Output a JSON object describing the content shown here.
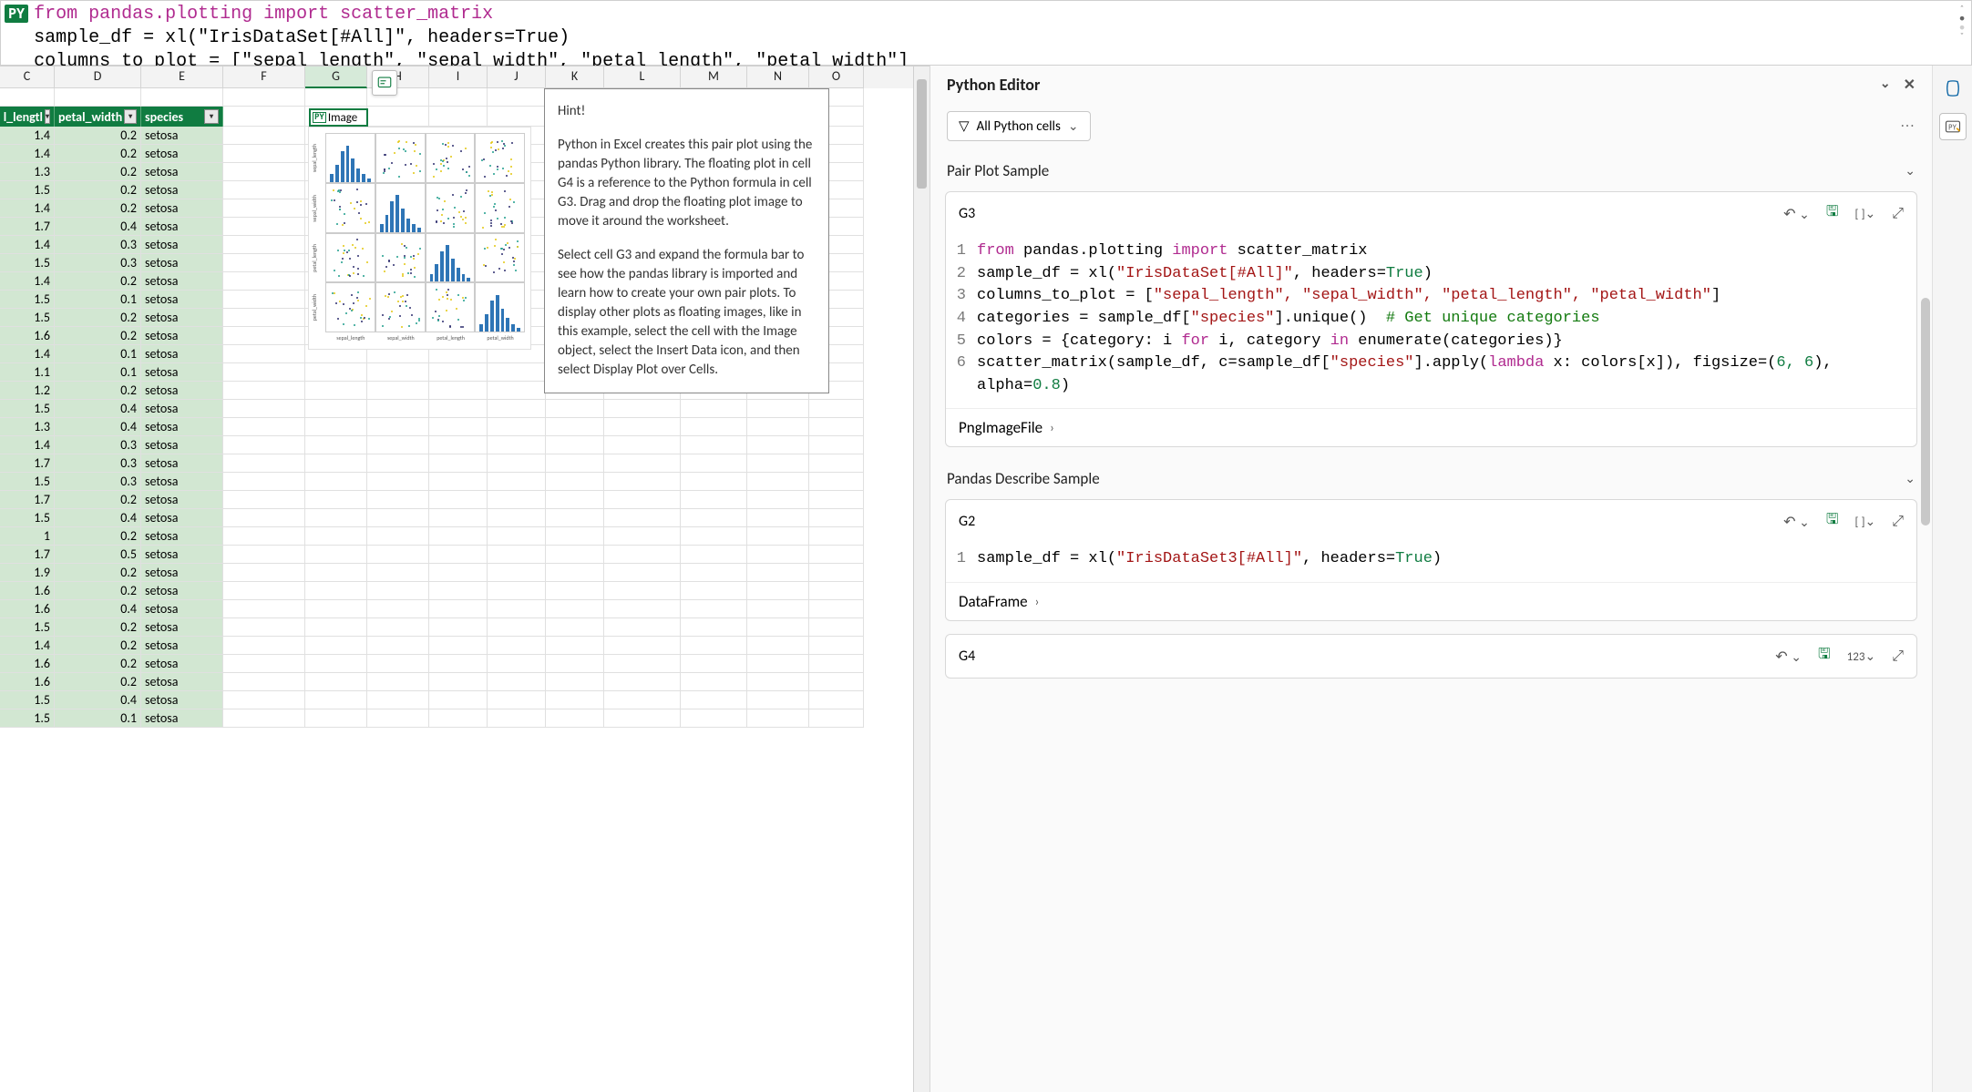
{
  "formula": {
    "badge": "PY",
    "line1": "from pandas.plotting import scatter_matrix",
    "line2": "sample_df = xl(\"IrisDataSet[#All]\", headers=True)",
    "line3": "columns_to_plot = [\"sepal_length\", \"sepal_width\", \"petal_length\", \"petal_width\"]"
  },
  "columns": [
    "C",
    "D",
    "E",
    "F",
    "G",
    "H",
    "I",
    "J",
    "K",
    "L",
    "M",
    "N",
    "O"
  ],
  "table_headers": {
    "c_partial": "l_lengtl",
    "d": "petal_width",
    "e": "species"
  },
  "rows": [
    [
      1.4,
      0.2,
      "setosa"
    ],
    [
      1.4,
      0.2,
      "setosa"
    ],
    [
      1.3,
      0.2,
      "setosa"
    ],
    [
      1.5,
      0.2,
      "setosa"
    ],
    [
      1.4,
      0.2,
      "setosa"
    ],
    [
      1.7,
      0.4,
      "setosa"
    ],
    [
      1.4,
      0.3,
      "setosa"
    ],
    [
      1.5,
      0.3,
      "setosa"
    ],
    [
      1.4,
      0.2,
      "setosa"
    ],
    [
      1.5,
      0.1,
      "setosa"
    ],
    [
      1.5,
      0.2,
      "setosa"
    ],
    [
      1.6,
      0.2,
      "setosa"
    ],
    [
      1.4,
      0.1,
      "setosa"
    ],
    [
      1.1,
      0.1,
      "setosa"
    ],
    [
      1.2,
      0.2,
      "setosa"
    ],
    [
      1.5,
      0.4,
      "setosa"
    ],
    [
      1.3,
      0.4,
      "setosa"
    ],
    [
      1.4,
      0.3,
      "setosa"
    ],
    [
      1.7,
      0.3,
      "setosa"
    ],
    [
      1.5,
      0.3,
      "setosa"
    ],
    [
      1.7,
      0.2,
      "setosa"
    ],
    [
      1.5,
      0.4,
      "setosa"
    ],
    [
      1,
      0.2,
      "setosa"
    ],
    [
      1.7,
      0.5,
      "setosa"
    ],
    [
      1.9,
      0.2,
      "setosa"
    ],
    [
      1.6,
      0.2,
      "setosa"
    ],
    [
      1.6,
      0.4,
      "setosa"
    ],
    [
      1.5,
      0.2,
      "setosa"
    ],
    [
      1.4,
      0.2,
      "setosa"
    ],
    [
      1.6,
      0.2,
      "setosa"
    ],
    [
      1.6,
      0.2,
      "setosa"
    ],
    [
      1.5,
      0.4,
      "setosa"
    ],
    [
      1.5,
      0.1,
      "setosa"
    ]
  ],
  "image_cell": {
    "badge": "PY",
    "label": "Image"
  },
  "scatter": {
    "labels": [
      "sepal_length",
      "sepal_width",
      "petal_length",
      "petal_width"
    ]
  },
  "hint": {
    "title": "Hint!",
    "p1": "Python in Excel creates this pair plot using the pandas Python library. The floating plot in cell G4 is a reference to the Python formula in cell G3. Drag and drop the floating plot image to move it around the worksheet.",
    "p2": "Select cell G3 and expand the formula bar to see how the pandas library is imported and learn how to create your own pair plots. To display other plots as floating images, like in this example, select the cell with the Image object, select the Insert Data icon, and then select Display Plot over Cells."
  },
  "panel": {
    "title": "Python Editor",
    "filter": "All Python cells",
    "section1": "Pair Plot Sample",
    "section2": "Pandas Describe Sample",
    "card1": {
      "ref": "G3",
      "result_type": "PngImageFile",
      "badge": "[ ]",
      "lines": [
        {
          "n": "1",
          "kw1": "from",
          "t1": " pandas.plotting ",
          "kw2": "import",
          "t2": " scatter_matrix"
        },
        {
          "n": "2",
          "t": "sample_df = xl(",
          "s": "\"IrisDataSet[#All]\"",
          "t2": ", headers=",
          "lit": "True",
          "t3": ")"
        },
        {
          "n": "3",
          "t": "columns_to_plot = [",
          "s": "\"sepal_length\", \"sepal_width\", \"petal_length\", \"petal_width\"",
          "t2": "]"
        },
        {
          "n": "4",
          "t": "categories = sample_df[",
          "s": "\"species\"",
          "t2": "].unique()  ",
          "c": "# Get unique categories"
        },
        {
          "n": "5",
          "t": "colors = {category: i ",
          "kw": "for",
          "t2": " i, category ",
          "kw2": "in",
          "t3": " enumerate(categories)}"
        },
        {
          "n": "6",
          "t": "scatter_matrix(sample_df, c=sample_df[",
          "s": "\"species\"",
          "t2": "].apply(",
          "kw": "lambda",
          "t3": " x: colors[x]), figsize=(",
          "lit": "6, 6",
          "t4": "), alpha=",
          "lit2": "0.8",
          "t5": ")"
        }
      ]
    },
    "card2": {
      "ref": "G2",
      "result_type": "DataFrame",
      "badge": "[ ]",
      "line": {
        "n": "1",
        "t": "sample_df = xl(",
        "s": "\"IrisDataSet3[#All]\"",
        "t2": ", headers=",
        "lit": "True",
        "t3": ")"
      }
    },
    "card3": {
      "ref": "G4",
      "badge": "123"
    }
  }
}
